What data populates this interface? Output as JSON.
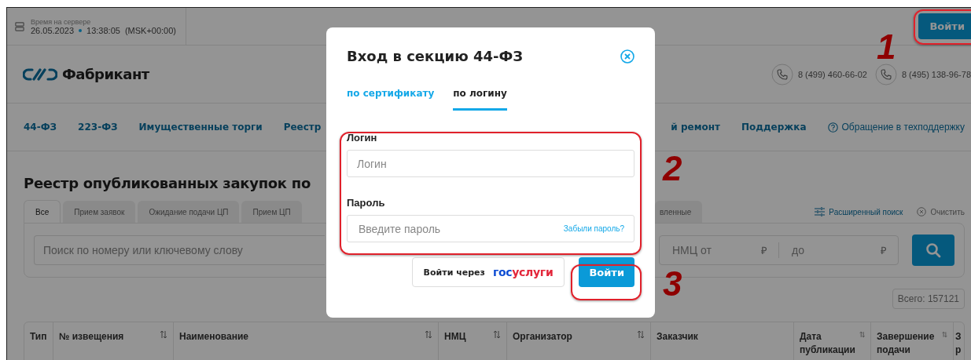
{
  "server_time": {
    "label": "Время на сервере",
    "date": "26.05.2023",
    "time": "13:38:05",
    "zone": "(MSK+00:00)"
  },
  "login_button": "Войти",
  "logo": "Фабрикант",
  "phones": [
    "8 (499) 460-66-02",
    "8 (495) 138-96-78"
  ],
  "nav_left": [
    "44-ФЗ",
    "223-ФЗ",
    "Имущественные торги",
    "Реестр"
  ],
  "nav_right": [
    "й ремонт",
    "Поддержка"
  ],
  "help_link": "Обращение в техподдержку",
  "heading": "Реестр опубликованных закупок по",
  "tabs_left": [
    {
      "label": "Все",
      "selected": true
    },
    {
      "label": "Прием заявок",
      "selected": false
    },
    {
      "label": "Ожидание подачи ЦП",
      "selected": false
    },
    {
      "label": "Прием ЦП",
      "selected": false
    }
  ],
  "tabs_right": [
    {
      "label": "вленные",
      "selected": false
    }
  ],
  "advanced_search": "Расширенный поиск",
  "clear": "Очистить",
  "search": {
    "placeholder": "Поиск по номеру или ключевому слову"
  },
  "price_from": {
    "placeholder": "НМЦ от",
    "currency": "₽"
  },
  "price_to": {
    "placeholder": "до",
    "currency": "₽"
  },
  "total": "Всего: 157121",
  "table": {
    "columns": [
      {
        "label": "Тип",
        "sortable": false
      },
      {
        "label": "№ извещения",
        "sortable": true
      },
      {
        "label": "Наименование",
        "sortable": true
      },
      {
        "label": "НМЦ",
        "sortable": true
      },
      {
        "label": "Организатор",
        "sortable": true
      },
      {
        "label": "Заказчик",
        "sortable": false
      },
      {
        "label": "Дата публикации",
        "sortable": true
      },
      {
        "label": "Завершение подачи",
        "sortable": true
      },
      {
        "label": "З р",
        "sortable": false
      }
    ]
  },
  "modal": {
    "title": "Вход в секцию 44-ФЗ",
    "tabs": [
      {
        "label": "по сертификату",
        "selected": false
      },
      {
        "label": "по логину",
        "selected": true
      }
    ],
    "login": {
      "label": "Логин",
      "placeholder": "Логин"
    },
    "password": {
      "label": "Пароль",
      "placeholder": "Введите пароль",
      "forgot": "Забыли пароль?"
    },
    "gosuslugi_button": {
      "label": "Войти через",
      "logo_parts": [
        "гос",
        "услуги"
      ]
    },
    "submit": "Войти"
  },
  "annotations": [
    "1",
    "2",
    "3"
  ]
}
